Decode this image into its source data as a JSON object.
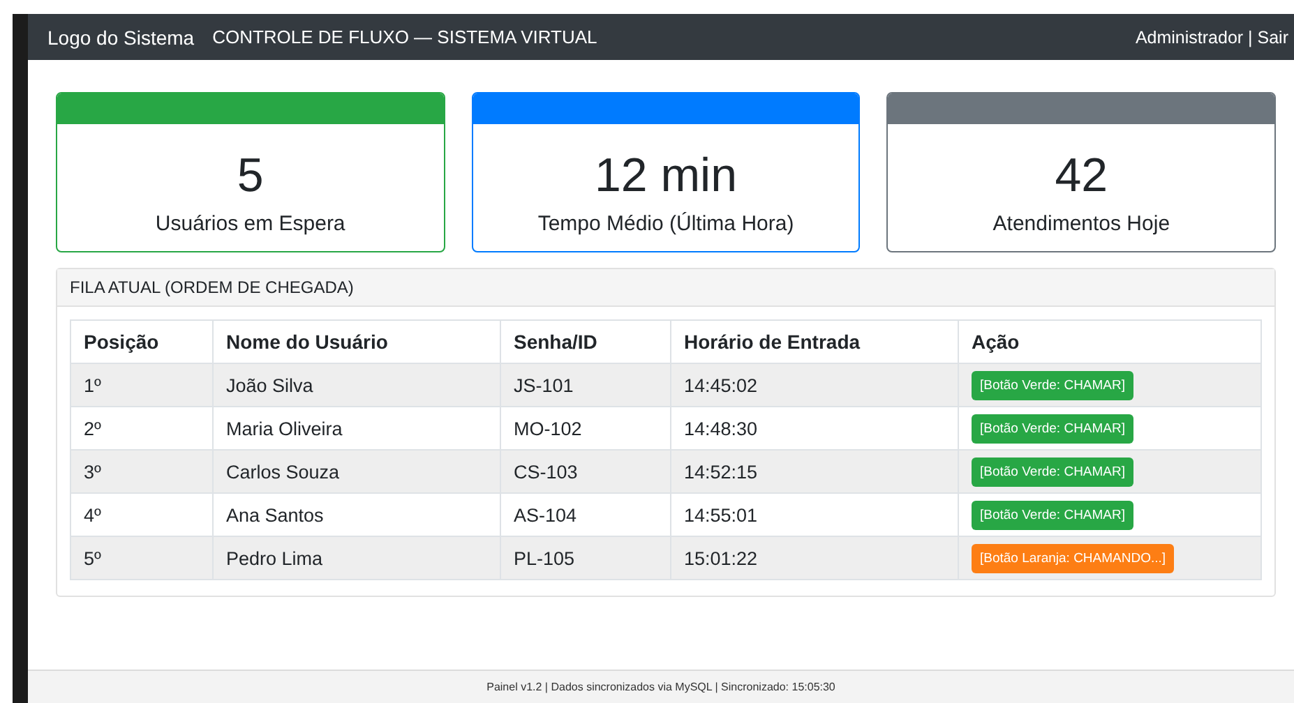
{
  "navbar": {
    "logo": "Logo do Sistema",
    "title": "CONTROLE DE FLUXO — SISTEMA VIRTUAL",
    "user": "Administrador | Sair"
  },
  "stats": [
    {
      "value": "5",
      "label": "Usuários em Espera",
      "color": "#28a745"
    },
    {
      "value": "12 min",
      "label": "Tempo Médio (Última Hora)",
      "color": "#007bff"
    },
    {
      "value": "42",
      "label": "Atendimentos Hoje",
      "color": "#6c757d"
    }
  ],
  "queue": {
    "title": "FILA ATUAL (ORDEM DE CHEGADA)",
    "columns": [
      "Posição",
      "Nome do Usuário",
      "Senha/ID",
      "Horário de Entrada",
      "Ação"
    ],
    "rows": [
      {
        "position": "1º",
        "name": "João Silva",
        "ticket": "JS-101",
        "time": "14:45:02",
        "action": {
          "kind": "call",
          "label": "[Botão Verde: CHAMAR]"
        }
      },
      {
        "position": "2º",
        "name": "Maria Oliveira",
        "ticket": "MO-102",
        "time": "14:48:30",
        "action": {
          "kind": "call",
          "label": "[Botão Verde: CHAMAR]"
        }
      },
      {
        "position": "3º",
        "name": "Carlos Souza",
        "ticket": "CS-103",
        "time": "14:52:15",
        "action": {
          "kind": "call",
          "label": "[Botão Verde: CHAMAR]"
        }
      },
      {
        "position": "4º",
        "name": "Ana Santos",
        "ticket": "AS-104",
        "time": "14:55:01",
        "action": {
          "kind": "call",
          "label": "[Botão Verde: CHAMAR]"
        }
      },
      {
        "position": "5º",
        "name": "Pedro Lima",
        "ticket": "PL-105",
        "time": "15:01:22",
        "action": {
          "kind": "calling",
          "label": "[Botão Laranja: CHAMANDO...]"
        }
      }
    ]
  },
  "footer": "Painel v1.2 | Dados sincronizados via MySQL | Sincronizado: 15:05:30"
}
